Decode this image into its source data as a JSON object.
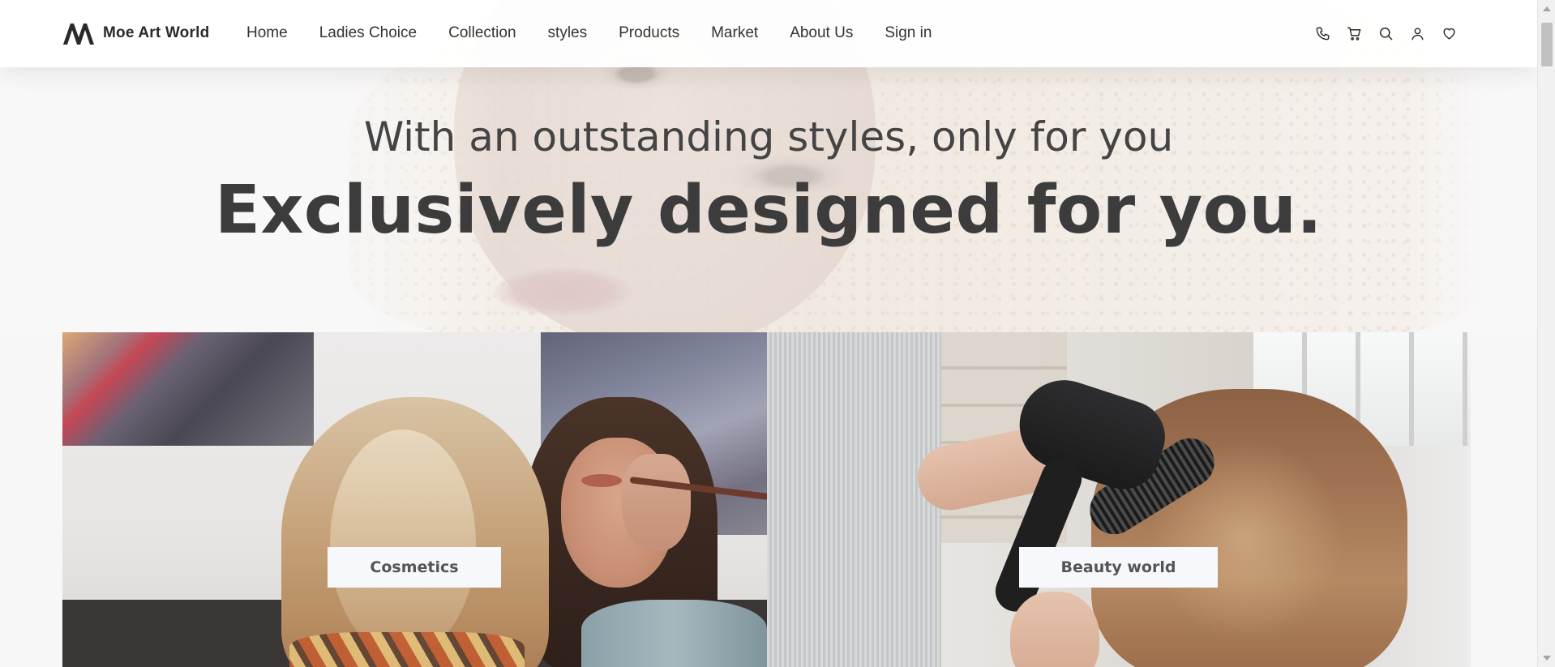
{
  "header": {
    "brand_name": "Moe Art World",
    "logo_icon": "mountain-m-logo",
    "nav": [
      {
        "label": "Home"
      },
      {
        "label": "Ladies Choice"
      },
      {
        "label": "Collection"
      },
      {
        "label": "styles"
      },
      {
        "label": "Products"
      },
      {
        "label": "Market"
      },
      {
        "label": "About Us"
      },
      {
        "label": "Sign in"
      }
    ],
    "icons": [
      "phone-icon",
      "cart-icon",
      "search-icon",
      "user-icon",
      "heart-icon"
    ]
  },
  "hero": {
    "subtitle": "With an outstanding styles, only for you",
    "title": "Exclusively designed for you."
  },
  "categories": [
    {
      "label": "Cosmetics"
    },
    {
      "label": "Beauty world"
    }
  ],
  "colors": {
    "text": "#333333",
    "heading": "#3c3c3c",
    "label_bg": "#f7f8fb",
    "page_bg": "#f7f7f8"
  }
}
